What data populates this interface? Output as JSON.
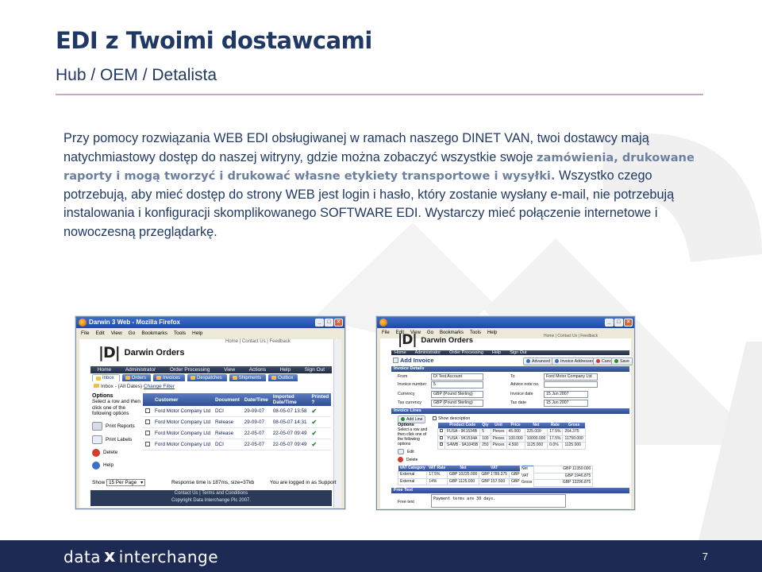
{
  "slide": {
    "title": "EDI z Twoimi dostawcami",
    "subtitle": "Hub / OEM / Detalista",
    "body_intro": "Przy pomocy rozwiązania WEB EDI obsługiwanej w ramach naszego DINET VAN, twoi dostawcy mają natychmiastowy dostęp do naszej witryny, gdzie można zobaczyć wszystkie swoje ",
    "body_highlight": "zamówienia, drukowane raporty i mogą tworzyć i drukować własne etykiety transportowe i wysyłki.",
    "body_rest": " Wszystko czego potrzebują, aby mieć dostęp do strony WEB jest login i hasło, który zostanie wysłany e-mail, nie potrzebują instalowania i konfiguracji skomplikowanego SOFTWARE EDI. Wystarczy mieć połączenie internetowe i nowoczesną przeglądarkę.",
    "page_number": "7"
  },
  "footer": {
    "brand_left": "data",
    "brand_x": "x",
    "brand_right": "interchange"
  },
  "colors": {
    "title": "#1f3864",
    "highlight": "#6d7fa0",
    "footer_bg": "#1c2a54",
    "nav_dark": "#2a3852",
    "tab_blue": "#3a66b8"
  },
  "screenshot_left": {
    "window_title": "Darwin 3 Web - Mozilla Firefox",
    "menu": [
      "File",
      "Edit",
      "View",
      "Go",
      "Bookmarks",
      "Tools",
      "Help"
    ],
    "top_links": "Home | Contact Us | Feedback",
    "logo_glyph": "|D|",
    "app_name": "Darwin Orders",
    "nav": [
      "Home",
      "Administrator",
      "Order Processing",
      "View",
      "Actions",
      "Help",
      "Sign Out"
    ],
    "tabs": [
      "Inbox",
      "Orders",
      "Invoices",
      "Despatches",
      "Shipments",
      "Outbox"
    ],
    "filter_label": "Inbox - (All Dates)",
    "filter_link": "Change Filter",
    "options_title": "Options",
    "options_desc": "Select a row and then click one of the following options",
    "options": [
      "Print Reports",
      "Print Labels",
      "Delete",
      "Help"
    ],
    "columns": [
      "Customer",
      "Document",
      "Date/Time",
      "Imported Date/Time",
      "Printed ?"
    ],
    "rows": [
      [
        "Ford Motor Company Ltd",
        "DCI",
        "29-09-07",
        "08-05-07 13:58"
      ],
      [
        "Ford Motor Company Ltd",
        "Release",
        "29-09-07",
        "08-05-07 14:31"
      ],
      [
        "Ford Motor Company Ltd",
        "Release",
        "22-05-07",
        "22-05-07 09:49"
      ],
      [
        "Ford Motor Company Ltd",
        "DCI",
        "22-05-07",
        "22-05-07 09:49"
      ]
    ],
    "show_label": "Show",
    "page_size": "15 Per Page",
    "response": "Response time is 187ms, size=37kb",
    "login_status": "You are logged in as Support",
    "copyright": [
      "Contact Us | Terms and Conditions",
      "Copyright Data Interchange Plc 2007."
    ]
  },
  "screenshot_right": {
    "menu": [
      "File",
      "Edit",
      "View",
      "Go",
      "Bookmarks",
      "Tools",
      "Help"
    ],
    "top_links": "Home | Contact Us | Feedback",
    "logo_glyph": "|D|",
    "app_name": "Darwin Orders",
    "nav": [
      "Home",
      "Administrator",
      "Order Processing",
      "Help",
      "Sign Out"
    ],
    "page_title": "Add Invoice",
    "buttons": [
      "Advanced",
      "Invoice Addresses",
      "Cancel",
      "Save"
    ],
    "section_details": "Invoice Details",
    "left_fields": [
      {
        "label": "From",
        "value": "DI Test Account"
      },
      {
        "label": "Invoice number",
        "value": "5"
      },
      {
        "label": "Currency",
        "value": "GBP (Pound Sterling)"
      },
      {
        "label": "Tax currency",
        "value": "GBP (Pound Sterling)"
      }
    ],
    "right_fields": [
      {
        "label": "To",
        "value": "Ford Motor Company Ltd"
      },
      {
        "label": "Advice note no.",
        "value": ""
      },
      {
        "label": "Invoice date",
        "value": "15  Jun  2007"
      },
      {
        "label": "Tax date",
        "value": "15  Jun  2007"
      }
    ],
    "section_lines": "Invoice Lines",
    "add_line": "Add Line",
    "show_description": "Show description",
    "line_options_title": "Options",
    "line_options_desc": "Select a row and then click one of the following options",
    "line_options": [
      "Edit",
      "Delete"
    ],
    "line_columns": [
      "Product Code",
      "Qty",
      "Unit",
      "Price",
      "Net",
      "Rate",
      "Gross"
    ],
    "line_rows": [
      [
        "FUSA - 9K1534B",
        "5",
        "Pieces",
        "45.000",
        "225.000",
        "17.5%",
        "264.375"
      ],
      [
        "YUSA - 9K1534A",
        "100",
        "Pieces",
        "100.000",
        "10000.000",
        "17.5%",
        "11750.000"
      ],
      [
        "S4WB - 9A1045B",
        "250",
        "Pieces",
        "4.500",
        "1125.000",
        "0.0%",
        "1125.000"
      ]
    ],
    "tax_columns": [
      "VAT Category",
      "VAT Rate",
      "Net",
      "VAT",
      "Gross"
    ],
    "tax_rows": [
      [
        "External",
        "17.5%",
        "GBP 10225.000",
        "GBP 1789.375",
        "GBP 12014.375"
      ],
      [
        "External",
        "14%",
        "GBP 1125.000",
        "GBP 157.500",
        "GBP 1282.500"
      ]
    ],
    "totals": [
      {
        "label": "Net",
        "value": "GBP 11350.000"
      },
      {
        "label": "VAT",
        "value": "GBP 1946.875"
      },
      {
        "label": "Gross",
        "value": "GBP 13296.875"
      }
    ],
    "section_free_text": "Free Text",
    "free_text_label": "Free text",
    "free_text_value": "Payment terms are 30 days."
  }
}
